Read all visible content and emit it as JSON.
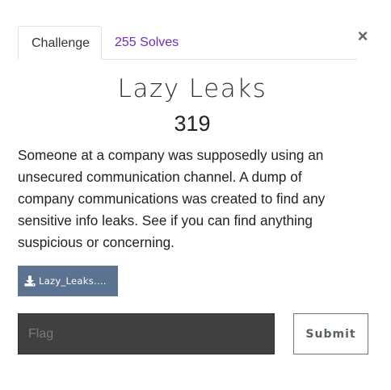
{
  "tabs": {
    "challenge_label": "Challenge",
    "solves_label": "255 Solves"
  },
  "close": {
    "glyph": "×",
    "icon": "close-icon"
  },
  "challenge": {
    "name": "Lazy Leaks",
    "value": "319",
    "description": "Someone at a company was supposedly using an unsecured communication channel. A dump of company communications was created to find any sensitive info leaks. See if you can find anything suspicious or concerning."
  },
  "file": {
    "label": "Lazy_Leaks.p...",
    "icon": "download-icon"
  },
  "form": {
    "flag_placeholder": "Flag",
    "flag_value": "",
    "submit_label": "Submit"
  },
  "colors": {
    "accent_link": "#6f2dbd",
    "file_button_bg": "#5b7290",
    "input_bg": "#404040"
  }
}
